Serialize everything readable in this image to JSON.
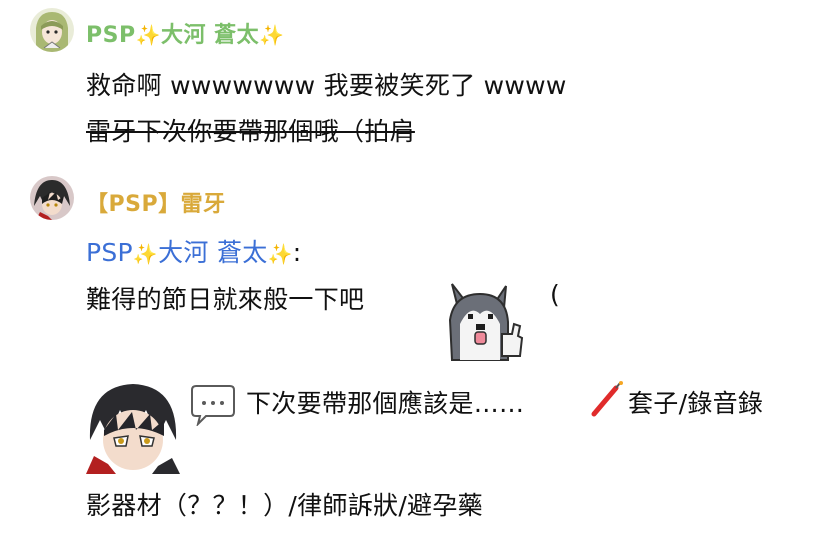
{
  "messages": [
    {
      "author": {
        "prefix": "PSP",
        "sparkle": "✨",
        "name": "大河 蒼太",
        "sparkle_end": "✨",
        "color": "#7cbf6a"
      },
      "lines": [
        "救命啊 wwwwwww 我要被笑死了 wwww",
        "雷牙下次你要帶那個哦（拍肩"
      ]
    },
    {
      "author": {
        "name": "【PSP】雷牙",
        "color": "#d9a93a"
      },
      "mention": {
        "prefix": "PSP",
        "sparkle": "✨",
        "name": "大河 蒼太",
        "sparkle_end": "✨",
        "colon": ":"
      },
      "line1": "難得的節日就來般一下吧",
      "line1_paren": "(",
      "line2_text": "下次要帶那個應該是……",
      "line2_after": "套子/錄音錄",
      "line3": "影器材（？？！）/律師訴狀/避孕藥"
    }
  ],
  "icons": {
    "speech_bubble": "speech-bubble-ellipsis-icon",
    "firecracker": "firecracker-icon",
    "sparkles": "sparkles-emoji"
  },
  "colors": {
    "mention": "#3b6fd6",
    "green_name": "#7cbf6a",
    "gold_name": "#d9a93a"
  }
}
